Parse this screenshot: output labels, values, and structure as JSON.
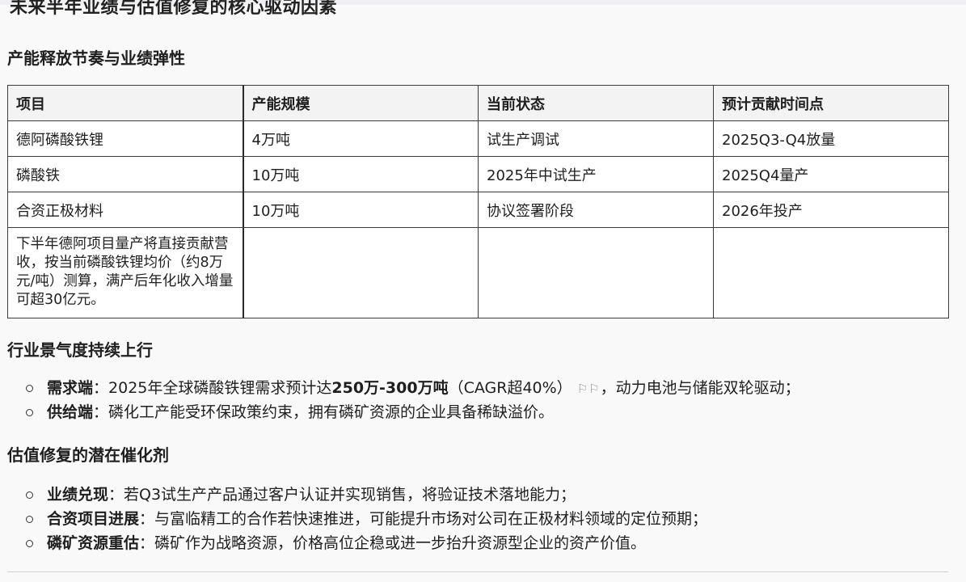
{
  "page_title": "未来半年业绩与估值修复的核心驱动因素",
  "sections": {
    "capacity": {
      "heading": "产能释放节奏与业绩弹性",
      "table": {
        "headers": [
          "项目",
          "产能规模",
          "当前状态",
          "预计贡献时间点"
        ],
        "rows": [
          [
            "德阿磷酸铁锂",
            "4万吨",
            "试生产调试",
            "2025Q3-Q4放量"
          ],
          [
            "磷酸铁",
            "10万吨",
            "2025年中试生产",
            "2025Q4量产"
          ],
          [
            "合资正极材料",
            "10万吨",
            "协议签署阶段",
            "2026年投产"
          ]
        ],
        "note": "下半年德阿项目量产将直接贡献营收，按当前磷酸铁锂均价（约8万元/吨）测算，满产后年化收入增量可超30亿元。"
      }
    },
    "industry": {
      "heading": "行业景气度持续上行",
      "items": [
        {
          "label": "需求端",
          "pre": "：2025年全球磷酸铁锂需求预计达",
          "bold": "250万-300万吨",
          "mid": "（CAGR超40%）",
          "flags": "⚐⚐",
          "post": "，动力电池与储能双轮驱动；"
        },
        {
          "label": "供给端",
          "text": "：磷化工产能受环保政策约束，拥有磷矿资源的企业具备稀缺溢价。"
        }
      ]
    },
    "valuation": {
      "heading": "估值修复的潜在催化剂",
      "items": [
        {
          "label": "业绩兑现",
          "text": "：若Q3试生产产品通过客户认证并实现销售，将验证技术落地能力；"
        },
        {
          "label": "合资项目进展",
          "text": "：与富临精工的合作若快速推进，可能提升市场对公司在正极材料领域的定位预期；"
        },
        {
          "label": "磷矿资源重估",
          "text": "：磷矿作为战略资源，价格高位企稳或进一步抬升资源型企业的资产价值。"
        }
      ]
    }
  }
}
